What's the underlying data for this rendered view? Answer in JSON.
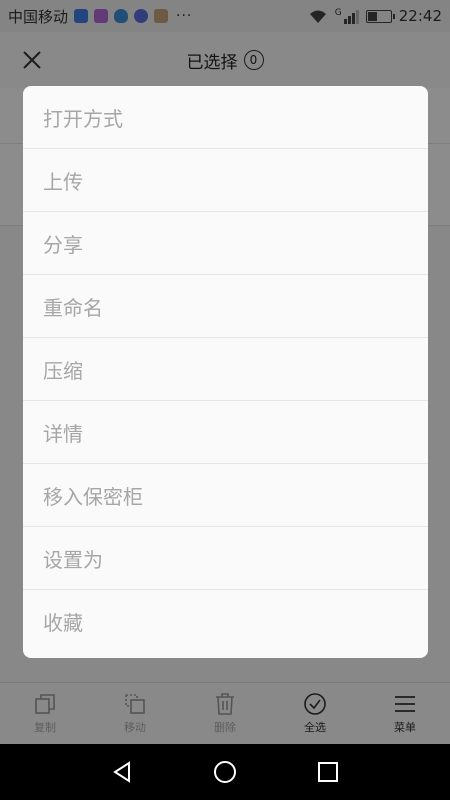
{
  "status_bar": {
    "carrier": "中国移动",
    "more": "···",
    "time": "22:42",
    "network": "G",
    "battery_level": 0.4,
    "app_icons": [
      {
        "name": "app-icon-blue",
        "color": "#3f7ee8"
      },
      {
        "name": "app-icon-purple",
        "color": "#b36ad8"
      },
      {
        "name": "shield-icon",
        "color": "#3b8fd8"
      },
      {
        "name": "music-icon",
        "color": "#5b6fe0"
      },
      {
        "name": "avatar-icon",
        "color": "#c9a47a"
      }
    ]
  },
  "header": {
    "title": "已选择",
    "count": "0"
  },
  "menu": {
    "items": [
      "打开方式",
      "上传",
      "分享",
      "重命名",
      "压缩",
      "详情",
      "移入保密柜",
      "设置为",
      "收藏"
    ]
  },
  "toolbar": {
    "items": [
      {
        "label": "复制",
        "icon": "copy-icon",
        "enabled": false
      },
      {
        "label": "移动",
        "icon": "move-icon",
        "enabled": false
      },
      {
        "label": "删除",
        "icon": "delete-icon",
        "enabled": false
      },
      {
        "label": "全选",
        "icon": "select-all-icon",
        "enabled": true
      },
      {
        "label": "菜单",
        "icon": "menu-icon",
        "enabled": true
      }
    ]
  },
  "nav": {
    "back": "back-icon",
    "home": "home-icon",
    "recents": "recents-icon"
  }
}
